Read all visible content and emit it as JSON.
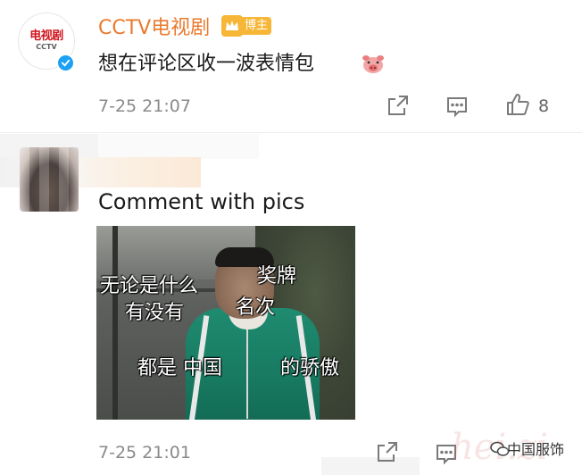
{
  "post": {
    "avatar_logo_top": "电视剧",
    "avatar_logo_bottom": "CCTV",
    "username": "CCTV电视剧",
    "badge": "博主",
    "text": "想在评论区收一波表情包",
    "time": "7-25 21:07",
    "like_count": "8"
  },
  "comment": {
    "text": "Comment with pics",
    "meme_captions": [
      "无论是什么",
      "奖牌",
      "有没有",
      "名次",
      "都是 中国",
      "的骄傲"
    ],
    "time": "7-25 21:01"
  },
  "watermark": {
    "label": "中国服饰",
    "ghost": "hei.zi"
  },
  "colors": {
    "username": "#ea7a2d",
    "badge": "#f6b637",
    "verified": "#1da1f2",
    "meta": "#8a8a8a"
  },
  "icons": {
    "share": "share-icon",
    "comment": "comment-icon",
    "like": "thumbs-up-icon",
    "verified": "verified-icon",
    "crown": "crown-icon",
    "emoji": "pig-emoji-icon"
  }
}
